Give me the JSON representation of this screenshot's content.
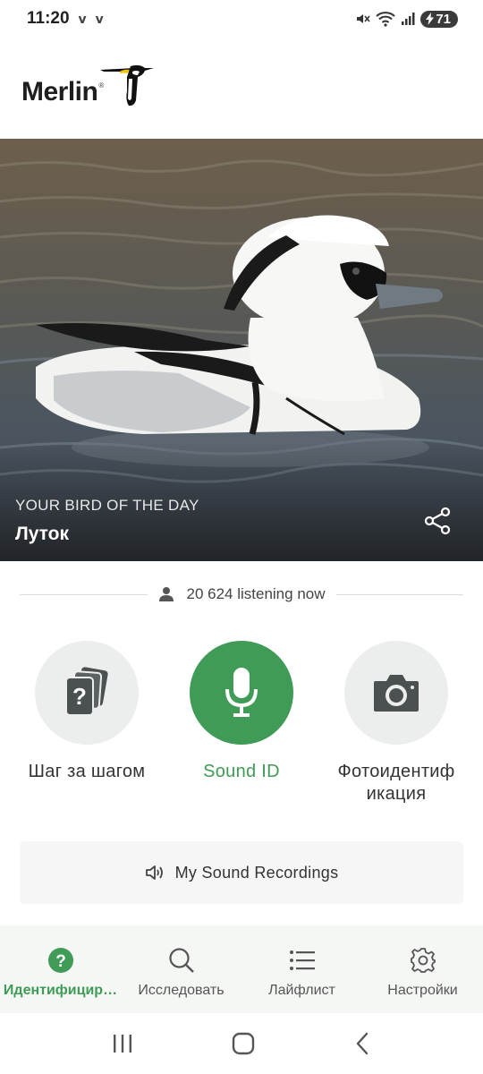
{
  "status": {
    "time": "11:20",
    "notifications": "ⅴ ⅴ",
    "battery": "71"
  },
  "app": {
    "logo_text": "Merlin",
    "logo_reg": "®"
  },
  "hero": {
    "label": "YOUR BIRD OF THE DAY",
    "bird_name": "Луток"
  },
  "listening": {
    "count_text": "20 624 listening now"
  },
  "tools": [
    {
      "label": "Шаг за шагом",
      "icon": "cards-question-icon"
    },
    {
      "label": "Sound ID",
      "icon": "microphone-icon"
    },
    {
      "label_line1": "Фотоидентиф",
      "label_line2": "икация",
      "icon": "camera-icon"
    }
  ],
  "recordings": {
    "label": "My Sound Recordings"
  },
  "nav": [
    {
      "label": "Идентифицир…",
      "active": true
    },
    {
      "label": "Исследовать"
    },
    {
      "label": "Лайфлист"
    },
    {
      "label": "Настройки"
    }
  ],
  "colors": {
    "accent": "#3f9b55",
    "tool_bg": "#eceeed",
    "icon_dark": "#4a5150"
  }
}
